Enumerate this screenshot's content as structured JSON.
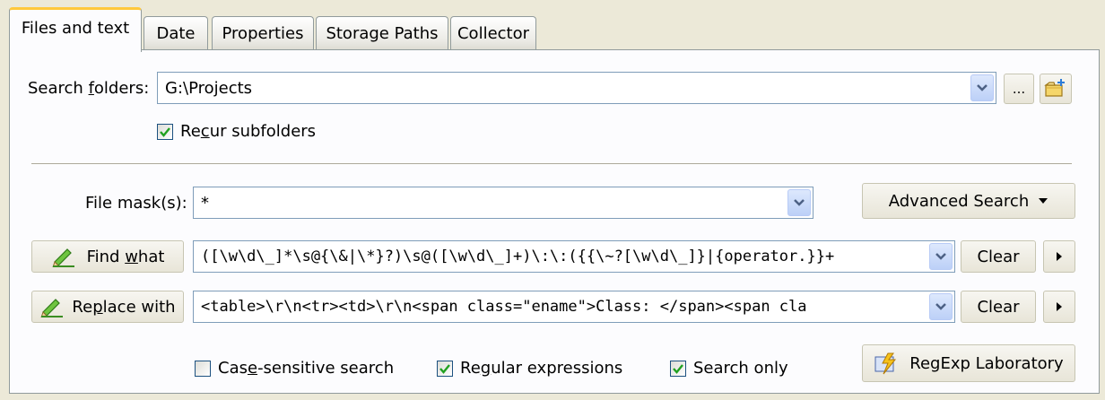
{
  "tabs": [
    {
      "label": "Files and text",
      "active": true
    },
    {
      "label": "Date",
      "active": false
    },
    {
      "label": "Properties",
      "active": false
    },
    {
      "label": "Storage Paths",
      "active": false
    },
    {
      "label": "Collector",
      "active": false
    }
  ],
  "search_folders": {
    "label_pre": "Search ",
    "label_u": "f",
    "label_post": "olders:",
    "value": "G:\\Projects",
    "browse_label": "..."
  },
  "recur": {
    "pre": "Re",
    "u": "c",
    "post": "ur subfolders",
    "checked": true
  },
  "file_mask": {
    "label": "File mask(s):",
    "value": "*"
  },
  "advanced_search": {
    "label": "Advanced Search"
  },
  "find_what": {
    "button_pre": "Find ",
    "button_u": "w",
    "button_post": "hat",
    "value": "([\\w\\d\\_]*\\s@{\\&|\\*}?)\\s@([\\w\\d\\_]+)\\:\\:({{\\~?[\\w\\d\\_]}|{operator.}}+",
    "clear_label": "Clear"
  },
  "replace_with": {
    "button_pre": "Re",
    "button_u": "p",
    "button_post": "lace with",
    "value": "<table>\\r\\n<tr><td>\\r\\n<span class=\"ename\">Class: </span><span cla",
    "clear_label": "Clear"
  },
  "options": {
    "case_sensitive": {
      "pre": "Cas",
      "u": "e",
      "post": "-sensitive search",
      "checked": false
    },
    "regex": {
      "pre": "Re",
      "u": "g",
      "post": "ular expressions",
      "checked": true
    },
    "search_only": {
      "pre": "Search only",
      "u": "",
      "post": "",
      "checked": true
    }
  },
  "regexp_lab": {
    "label": "RegExp Laboratory"
  },
  "colors": {
    "accent_tab": "#ffc83c",
    "check": "#21a121",
    "border": "#7f9db9"
  }
}
